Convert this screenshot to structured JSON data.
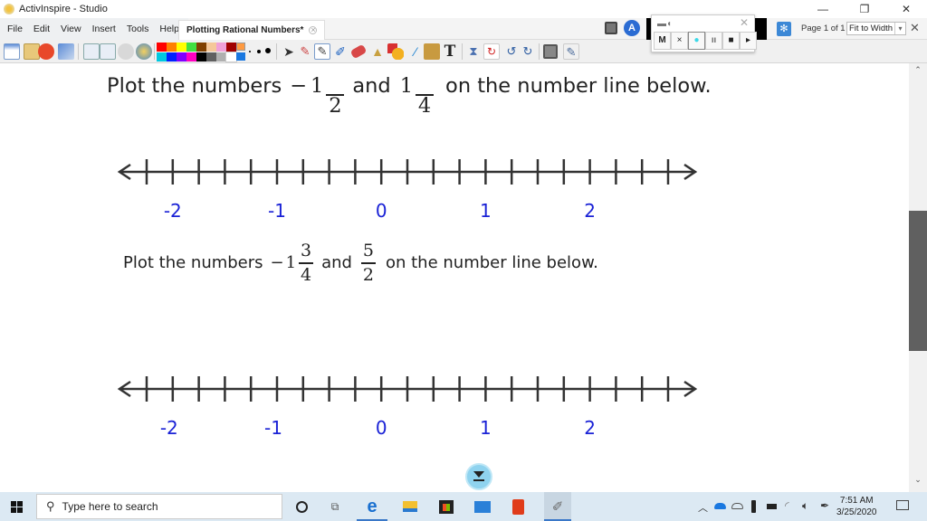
{
  "window": {
    "app_title": "ActivInspire - Studio",
    "controls": {
      "minimize": "—",
      "restore": "❐",
      "close": "✕"
    }
  },
  "menubar": {
    "items": [
      "File",
      "Edit",
      "View",
      "Insert",
      "Tools",
      "Help"
    ],
    "document_tab": "Plotting Rational Numbers*",
    "document_tab_close": "×"
  },
  "toolbar": {
    "left_tools": [
      "browsers-icon",
      "profile-icon",
      "dual-user-icon",
      "desktop-annotate-icon",
      "previous-page-icon",
      "next-page-icon",
      "play-icon",
      "web-browser-icon"
    ],
    "colors": [
      "#ff0000",
      "#ff8000",
      "#ffff00",
      "#40e040",
      "#804000",
      "#f5c89a",
      "#f0a0d8",
      "#a00000",
      "#00c8e0",
      "#0020ff",
      "#8000ff",
      "#ff00c0",
      "#000000",
      "#606060",
      "#b0b0b0",
      "#ffffff"
    ],
    "current_color_top": "#ff9a40",
    "current_color_bottom": "#1a78e0",
    "pen_widths": [
      "small",
      "medium",
      "large",
      "xlarge"
    ],
    "right_tools": [
      "select-icon",
      "magic-ink-icon",
      "pen-icon",
      "highlighter-icon",
      "eraser-icon",
      "fill-icon",
      "shape-icon",
      "connector-icon",
      "clip-icon",
      "text-icon",
      "clear-icon",
      "reset-icon",
      "undo-icon",
      "redo-icon",
      "page-browser-icon",
      "trays-icon"
    ]
  },
  "recorder": {
    "buttons": [
      "M",
      "×",
      "●",
      "ıı",
      "■",
      "▸"
    ],
    "close": "✕"
  },
  "pagebar": {
    "page_info": "Page 1 of 1",
    "zoom_select": "Fit to Width"
  },
  "content": {
    "problem1": {
      "prefix": "Plot the numbers",
      "first": {
        "sign": "−",
        "whole": "1",
        "numerator": "",
        "denominator": "2"
      },
      "connector": "and",
      "second": {
        "sign": "",
        "whole": "1",
        "numerator": "",
        "denominator": "4"
      },
      "suffix": "on the number line below."
    },
    "numberline1": {
      "min_tick": -2.25,
      "max_tick": 2.75,
      "tick_step": 0.25,
      "labels": [
        {
          "value": -2,
          "text": "-2"
        },
        {
          "value": -1,
          "text": "-1"
        },
        {
          "value": 0,
          "text": "0"
        },
        {
          "value": 1,
          "text": "1"
        },
        {
          "value": 2,
          "text": "2"
        }
      ]
    },
    "problem2": {
      "prefix": "Plot the numbers",
      "first": {
        "sign": "−",
        "whole": "1",
        "numerator": "3",
        "denominator": "4"
      },
      "connector": "and",
      "second": {
        "sign": "",
        "whole": "",
        "numerator": "5",
        "denominator": "2"
      },
      "suffix": "on the number line below."
    },
    "numberline2": {
      "min_tick": -2.25,
      "max_tick": 2.75,
      "tick_step": 0.25,
      "labels": [
        {
          "value": -2,
          "text": "-2"
        },
        {
          "value": -1,
          "text": "-1"
        },
        {
          "value": 0,
          "text": "0"
        },
        {
          "value": 1,
          "text": "1"
        },
        {
          "value": 2,
          "text": "2"
        }
      ]
    }
  },
  "scrollbar": {
    "up": "⌃",
    "down": "⌄",
    "position_fraction": 0.35
  },
  "taskbar": {
    "search_placeholder": "Type here to search",
    "apps": [
      "cortana-icon",
      "task-view-icon",
      "edge-icon",
      "file-explorer-icon",
      "store-icon",
      "mail-icon",
      "office-icon",
      "activinspire-icon"
    ],
    "tray": [
      "show-hidden-icon",
      "onedrive-icon",
      "cloud-icon",
      "usb-icon",
      "battery-icon",
      "wifi-icon",
      "volume-icon",
      "pen-icon"
    ],
    "time": "7:51 AM",
    "date": "3/25/2020"
  }
}
